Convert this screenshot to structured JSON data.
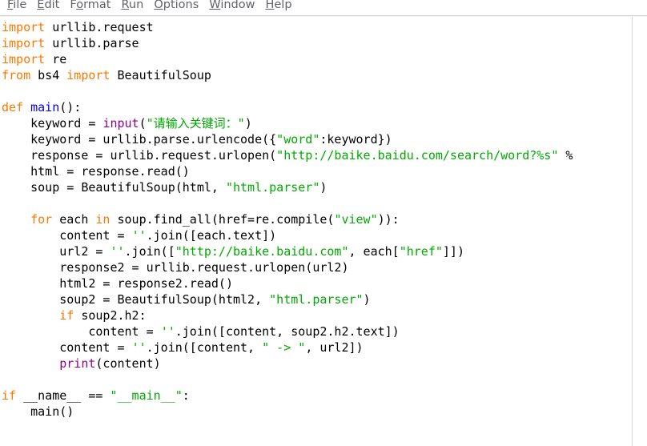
{
  "window": {
    "app": "Python IDLE editor",
    "background": "#ffffff"
  },
  "menubar": {
    "items": [
      {
        "label": "File",
        "mnemonic": "F"
      },
      {
        "label": "Edit",
        "mnemonic": "E"
      },
      {
        "label": "Format",
        "mnemonic": "o"
      },
      {
        "label": "Run",
        "mnemonic": "R"
      },
      {
        "label": "Options",
        "mnemonic": "O"
      },
      {
        "label": "Window",
        "mnemonic": "W"
      },
      {
        "label": "Help",
        "mnemonic": "H"
      }
    ]
  },
  "colors": {
    "keyword": "#ff7700",
    "definition": "#0000ff",
    "builtin": "#900090",
    "string": "#00aa00",
    "text": "#000000",
    "menu_text": "#62626b",
    "background": "#ffffff"
  },
  "editor": {
    "language": "Python",
    "lines": [
      "import urllib.request",
      "import urllib.parse",
      "import re",
      "from bs4 import BeautifulSoup",
      "",
      "def main():",
      "    keyword = input(\"请输入关键词：\")",
      "    keyword = urllib.parse.urlencode({\"word\":keyword})",
      "    response = urllib.request.urlopen(\"http://baike.baidu.com/search/word?%s\" %",
      "    html = response.read()",
      "    soup = BeautifulSoup(html, \"html.parser\")",
      "",
      "    for each in soup.find_all(href=re.compile(\"view\")):",
      "        content = ''.join([each.text])",
      "        url2 = ''.join([\"http://baike.baidu.com\", each[\"href\"]])",
      "        response2 = urllib.request.urlopen(url2)",
      "        html2 = response2.read()",
      "        soup2 = BeautifulSoup(html2, \"html.parser\")",
      "        if soup2.h2:",
      "            content = ''.join([content, soup2.h2.text])",
      "        content = ''.join([content, \" -> \", url2])",
      "        print(content)",
      "",
      "if __name__ == \"__main__\":",
      "    main()"
    ],
    "tokens": {
      "l1": [
        {
          "t": "import",
          "c": "kw"
        },
        {
          "t": " urllib.request",
          "c": "pl"
        }
      ],
      "l2": [
        {
          "t": "import",
          "c": "kw"
        },
        {
          "t": " urllib.parse",
          "c": "pl"
        }
      ],
      "l3": [
        {
          "t": "import",
          "c": "kw"
        },
        {
          "t": " re",
          "c": "pl"
        }
      ],
      "l4": [
        {
          "t": "from",
          "c": "kw"
        },
        {
          "t": " bs4 ",
          "c": "pl"
        },
        {
          "t": "import",
          "c": "kw"
        },
        {
          "t": " BeautifulSoup",
          "c": "pl"
        }
      ],
      "l6": [
        {
          "t": "def",
          "c": "kw"
        },
        {
          "t": " ",
          "c": "pl"
        },
        {
          "t": "main",
          "c": "def"
        },
        {
          "t": "():",
          "c": "pl"
        }
      ],
      "l7": [
        {
          "t": "    keyword = ",
          "c": "pl"
        },
        {
          "t": "input",
          "c": "bi"
        },
        {
          "t": "(",
          "c": "pl"
        },
        {
          "t": "\"请输入关键词：\"",
          "c": "str"
        },
        {
          "t": ")",
          "c": "pl"
        }
      ],
      "l8": [
        {
          "t": "    keyword = urllib.parse.urlencode({",
          "c": "pl"
        },
        {
          "t": "\"word\"",
          "c": "str"
        },
        {
          "t": ":keyword})",
          "c": "pl"
        }
      ],
      "l9": [
        {
          "t": "    response = urllib.request.urlopen(",
          "c": "pl"
        },
        {
          "t": "\"http://baike.baidu.com/search/word?%s\"",
          "c": "str"
        },
        {
          "t": " %",
          "c": "pl"
        }
      ],
      "l10": [
        {
          "t": "    html = response.read()",
          "c": "pl"
        }
      ],
      "l11": [
        {
          "t": "    soup = BeautifulSoup(html, ",
          "c": "pl"
        },
        {
          "t": "\"html.parser\"",
          "c": "str"
        },
        {
          "t": ")",
          "c": "pl"
        }
      ],
      "l13": [
        {
          "t": "    ",
          "c": "pl"
        },
        {
          "t": "for",
          "c": "kw"
        },
        {
          "t": " each ",
          "c": "pl"
        },
        {
          "t": "in",
          "c": "kw"
        },
        {
          "t": " soup.find_all(href=re.compile(",
          "c": "pl"
        },
        {
          "t": "\"view\"",
          "c": "str"
        },
        {
          "t": ")):",
          "c": "pl"
        }
      ],
      "l14": [
        {
          "t": "        content = ",
          "c": "pl"
        },
        {
          "t": "''",
          "c": "str"
        },
        {
          "t": ".join([each.text])",
          "c": "pl"
        }
      ],
      "l15": [
        {
          "t": "        url2 = ",
          "c": "pl"
        },
        {
          "t": "''",
          "c": "str"
        },
        {
          "t": ".join([",
          "c": "pl"
        },
        {
          "t": "\"http://baike.baidu.com\"",
          "c": "str"
        },
        {
          "t": ", each[",
          "c": "pl"
        },
        {
          "t": "\"href\"",
          "c": "str"
        },
        {
          "t": "]])",
          "c": "pl"
        }
      ],
      "l16": [
        {
          "t": "        response2 = urllib.request.urlopen(url2)",
          "c": "pl"
        }
      ],
      "l17": [
        {
          "t": "        html2 = response2.read()",
          "c": "pl"
        }
      ],
      "l18": [
        {
          "t": "        soup2 = BeautifulSoup(html2, ",
          "c": "pl"
        },
        {
          "t": "\"html.parser\"",
          "c": "str"
        },
        {
          "t": ")",
          "c": "pl"
        }
      ],
      "l19": [
        {
          "t": "        ",
          "c": "pl"
        },
        {
          "t": "if",
          "c": "kw"
        },
        {
          "t": " soup2.h2:",
          "c": "pl"
        }
      ],
      "l20": [
        {
          "t": "            content = ",
          "c": "pl"
        },
        {
          "t": "''",
          "c": "str"
        },
        {
          "t": ".join([content, soup2.h2.text])",
          "c": "pl"
        }
      ],
      "l21": [
        {
          "t": "        content = ",
          "c": "pl"
        },
        {
          "t": "''",
          "c": "str"
        },
        {
          "t": ".join([content, ",
          "c": "pl"
        },
        {
          "t": "\" -> \"",
          "c": "str"
        },
        {
          "t": ", url2])",
          "c": "pl"
        }
      ],
      "l22": [
        {
          "t": "        ",
          "c": "pl"
        },
        {
          "t": "print",
          "c": "bi"
        },
        {
          "t": "(content)",
          "c": "pl"
        }
      ],
      "l24": [
        {
          "t": "if",
          "c": "kw"
        },
        {
          "t": " __name__ == ",
          "c": "pl"
        },
        {
          "t": "\"__main__\"",
          "c": "str"
        },
        {
          "t": ":",
          "c": "pl"
        }
      ],
      "l25": [
        {
          "t": "    main()",
          "c": "pl"
        }
      ]
    },
    "token_order": [
      "l1",
      "l2",
      "l3",
      "l4",
      "blank",
      "l6",
      "l7",
      "l8",
      "l9",
      "l10",
      "l11",
      "blank",
      "l13",
      "l14",
      "l15",
      "l16",
      "l17",
      "l18",
      "l19",
      "l20",
      "l21",
      "l22",
      "blank",
      "l24",
      "l25"
    ]
  }
}
